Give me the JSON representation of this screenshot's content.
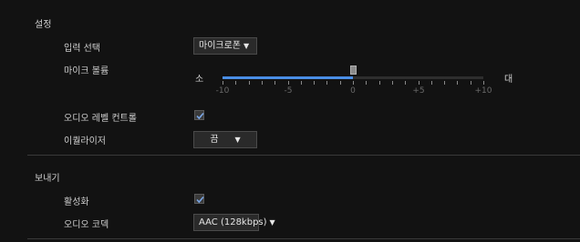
{
  "settings": {
    "title": "설정",
    "input_select": {
      "label": "입력 선택",
      "value": "마이크로폰"
    },
    "mic_volume": {
      "label": "마이크 볼륨",
      "min_label": "소",
      "max_label": "대",
      "value": 0,
      "range": [
        -10,
        10
      ],
      "tick_labels": [
        "-10",
        "-5",
        "0",
        "+5",
        "+10"
      ]
    },
    "audio_level_control": {
      "label": "오디오 레벨 컨트롤",
      "checked": true
    },
    "equalizer": {
      "label": "이퀄라이저",
      "value": "끔"
    }
  },
  "send": {
    "title": "보내기",
    "enable": {
      "label": "활성화",
      "checked": true
    },
    "audio_codec": {
      "label": "오디오 코덱",
      "value": "AAC (128kbps)"
    }
  },
  "icons": {
    "dropdown_arrow": "▼",
    "check": "checkmark-icon"
  },
  "colors": {
    "background": "#121212",
    "slider_fill": "#4a8ee6",
    "checkmark": "#7aa6e6"
  }
}
